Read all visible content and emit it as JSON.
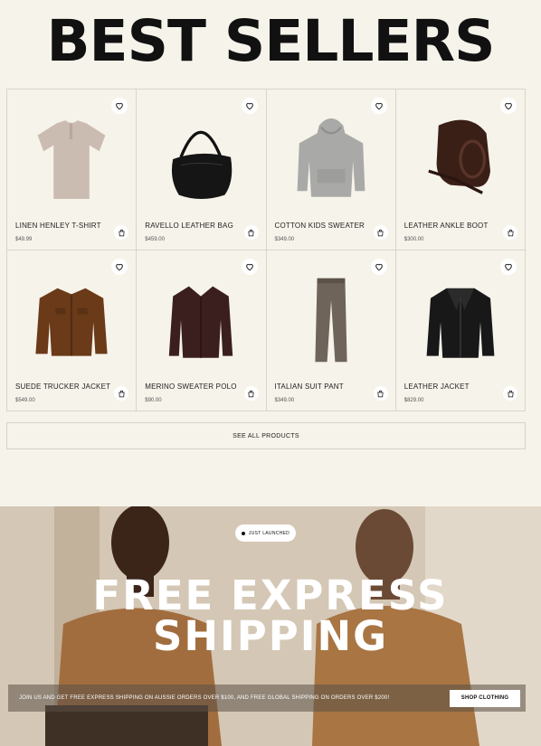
{
  "page": {
    "title": "BEST SELLERS"
  },
  "products": [
    {
      "name": "LINEN HENLEY T-SHIRT",
      "price": "$49.99",
      "image": "henley-tshirt"
    },
    {
      "name": "RAVELLO LEATHER BAG",
      "price": "$459.00",
      "image": "leather-bag"
    },
    {
      "name": "COTTON KIDS SWEATER",
      "price": "$349.00",
      "image": "hoodie"
    },
    {
      "name": "LEATHER ANKLE BOOT",
      "price": "$300.00",
      "image": "ankle-boot"
    },
    {
      "name": "SUEDE TRUCKER JACKET",
      "price": "$549.00",
      "image": "trucker-jacket"
    },
    {
      "name": "MERINO SWEATER POLO",
      "price": "$90.00",
      "image": "sweater-polo"
    },
    {
      "name": "ITALIAN SUIT PANT",
      "price": "$349.00",
      "image": "suit-pant"
    },
    {
      "name": "LEATHER JACKET",
      "price": "$829.00",
      "image": "leather-jacket"
    }
  ],
  "see_all": {
    "label": "SEE ALL PRODUCTS"
  },
  "hero": {
    "badge": "JUST LAUNCHED",
    "title_line1": "FREE EXPRESS",
    "title_line2": "SHIPPING",
    "promo": "JOIN US AND GET FREE EXPRESS SHIPPING ON AUSSIE ORDERS OVER $100, AND FREE GLOBAL SHIPPING ON ORDERS OVER $200!",
    "button": "SHOP CLOTHING"
  },
  "icons": {
    "favorite": "heart-icon",
    "cart": "bag-icon"
  },
  "colors": {
    "background": "#f6f3ea",
    "border": "#d9d5cb",
    "text": "#111111"
  }
}
